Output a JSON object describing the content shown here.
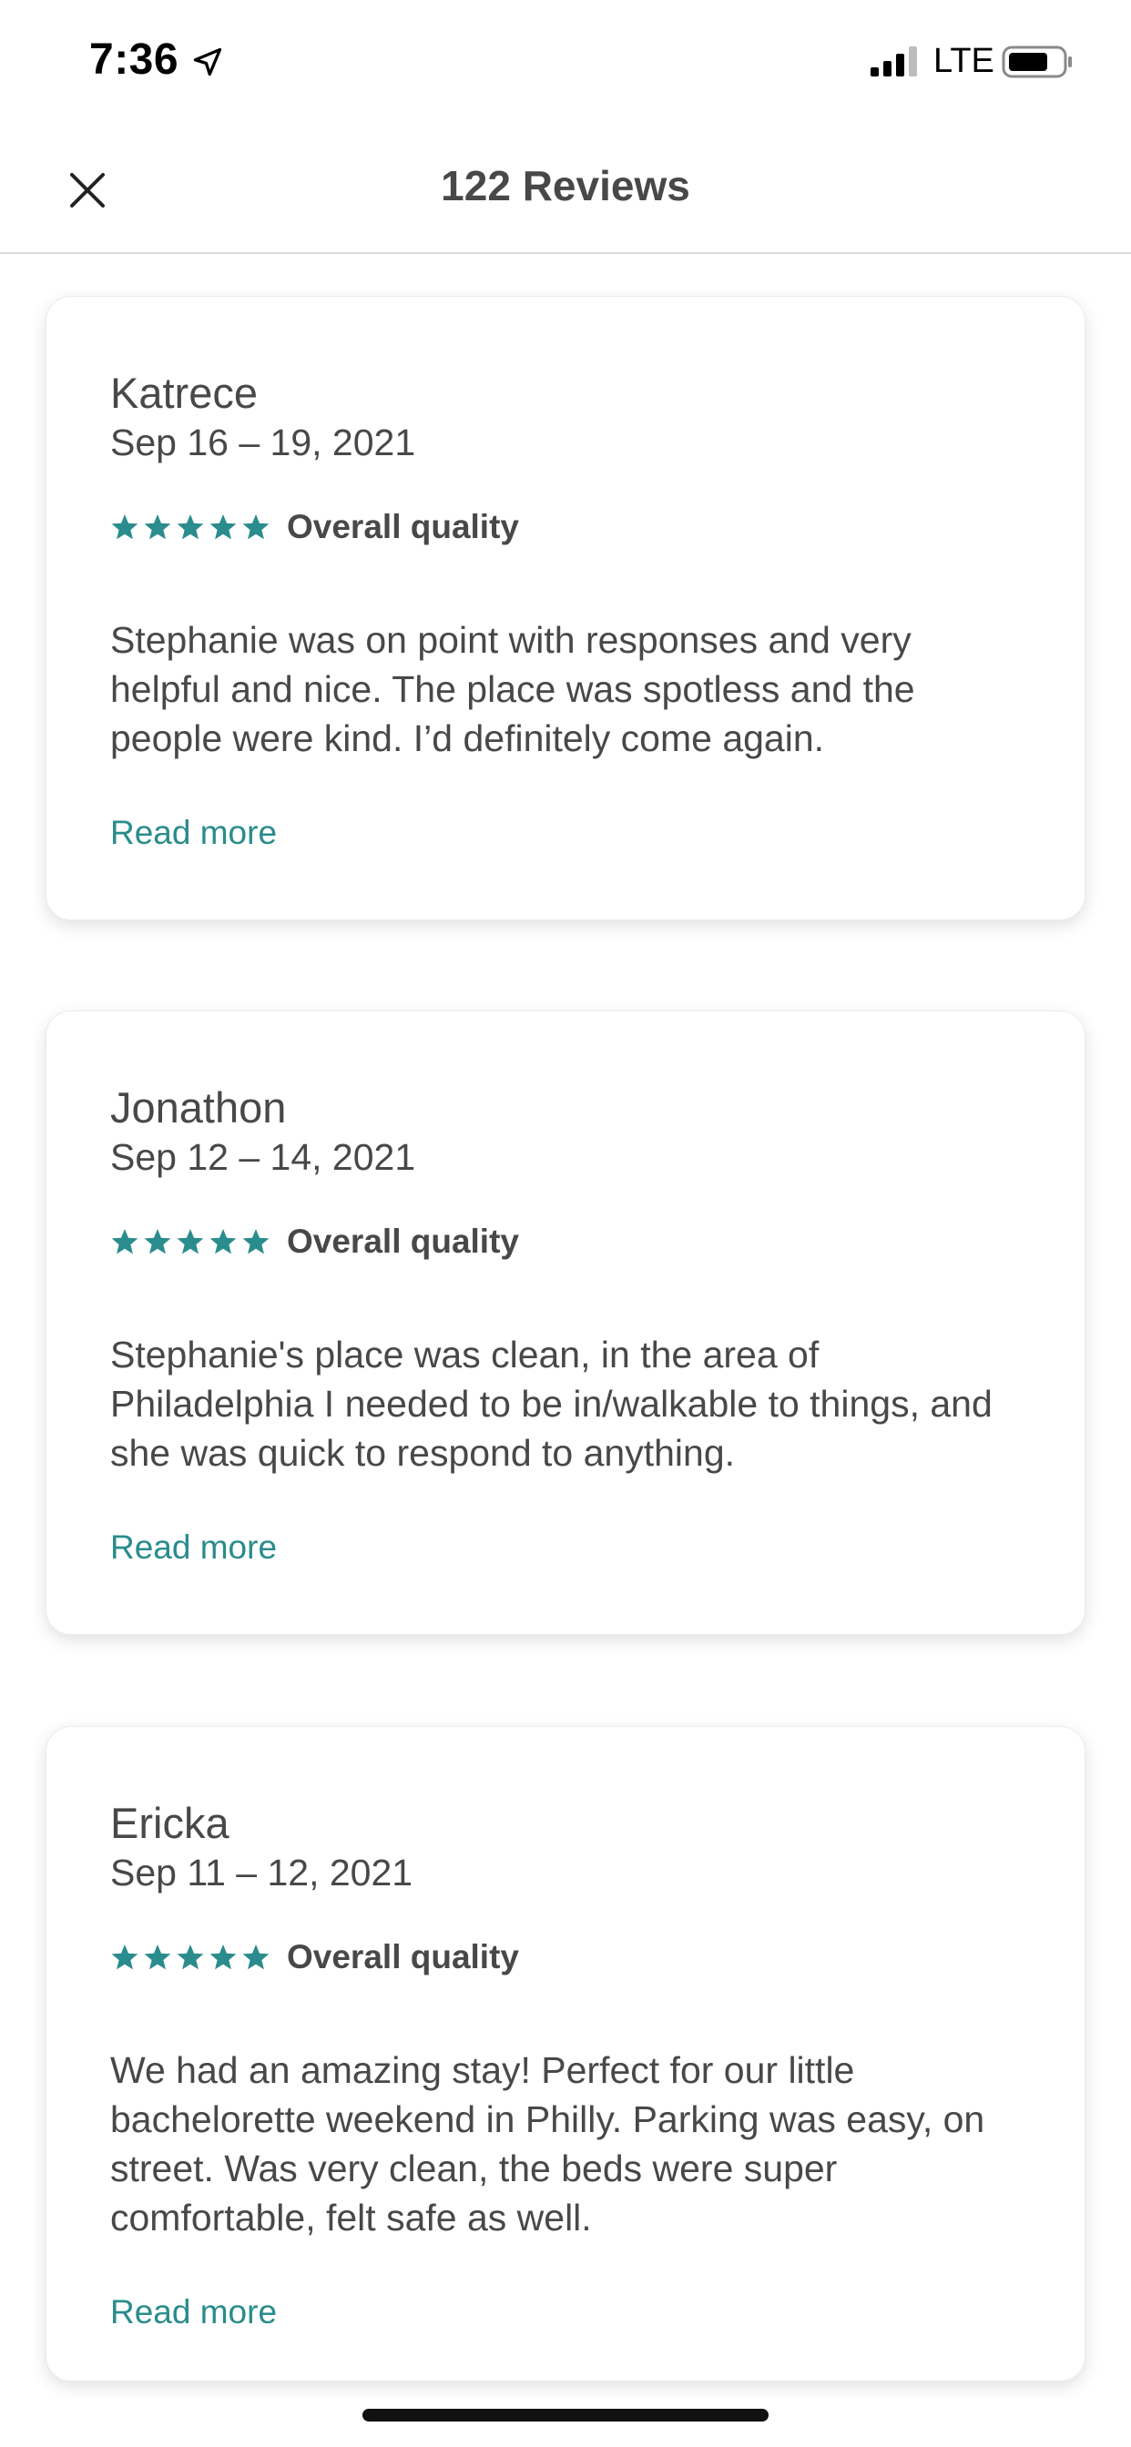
{
  "status_bar": {
    "time": "7:36",
    "network": "LTE",
    "icons": [
      "location-arrow-icon",
      "signal-icon",
      "battery-icon"
    ]
  },
  "header": {
    "title": "122 Reviews",
    "close_icon": "close-icon"
  },
  "colors": {
    "accent": "#2a8c8c",
    "text": "#484848",
    "star": "#2a8c8c"
  },
  "reviews": [
    {
      "name": "Katrece",
      "date": "Sep 16 – 19, 2021",
      "rating": 5,
      "rating_label": "Overall quality",
      "text": "Stephanie was on point with responses and very helpful and nice. The place was spotless and the people were kind. I’d definitely come again.",
      "read_more": "Read more"
    },
    {
      "name": "Jonathon",
      "date": "Sep 12 – 14, 2021",
      "rating": 5,
      "rating_label": "Overall quality",
      "text": "Stephanie's place was clean, in the area of Philadelphia I needed to be in/walkable to things, and she was quick to respond to anything.",
      "read_more": "Read more"
    },
    {
      "name": "Ericka",
      "date": "Sep 11 – 12, 2021",
      "rating": 5,
      "rating_label": "Overall quality",
      "text": "We had an amazing stay! Perfect for our little bachelorette weekend in Philly. Parking was easy, on street. Was very clean, the beds were super comfortable, felt safe as well.",
      "read_more": "Read more"
    }
  ]
}
